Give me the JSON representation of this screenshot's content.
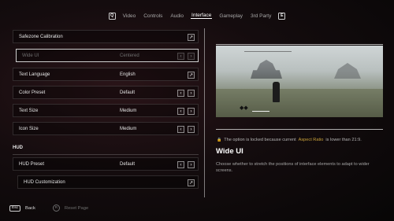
{
  "nav": {
    "left_key": "Q",
    "right_key": "E",
    "tabs": [
      "Video",
      "Controls",
      "Audio",
      "Interface",
      "Gameplay",
      "3rd Party"
    ],
    "active_tab": "Interface"
  },
  "settings": {
    "safezone": {
      "label": "Safezone Calibration"
    },
    "wide_ui": {
      "label": "Wide UI",
      "value": "Centered",
      "disabled": true
    },
    "text_language": {
      "label": "Text Language",
      "value": "English"
    },
    "color_preset": {
      "label": "Color Preset",
      "value": "Default"
    },
    "text_size": {
      "label": "Text Size",
      "value": "Medium"
    },
    "icon_size": {
      "label": "Icon Size",
      "value": "Medium"
    }
  },
  "hud": {
    "section_title": "HUD",
    "preset": {
      "label": "HUD Preset",
      "value": "Default"
    },
    "customization": {
      "label": "HUD Customization"
    }
  },
  "glyphs": {
    "open": "↗",
    "prev": "‹",
    "next": "›",
    "lock": "🔒"
  },
  "info": {
    "lock_prefix": "The option is locked because current",
    "lock_accent": "Aspect Ratio",
    "lock_suffix": "is lower than 21:9.",
    "title": "Wide UI",
    "description": "Choose whether to stretch the positions of interface elements to adapt to wider screens."
  },
  "bottom": {
    "back_key": "Esc",
    "back_label": "Back",
    "reset_key": "R",
    "reset_label": "Reset Page"
  },
  "colors": {
    "accent": "#c9a23a",
    "background": "#140c0e"
  }
}
